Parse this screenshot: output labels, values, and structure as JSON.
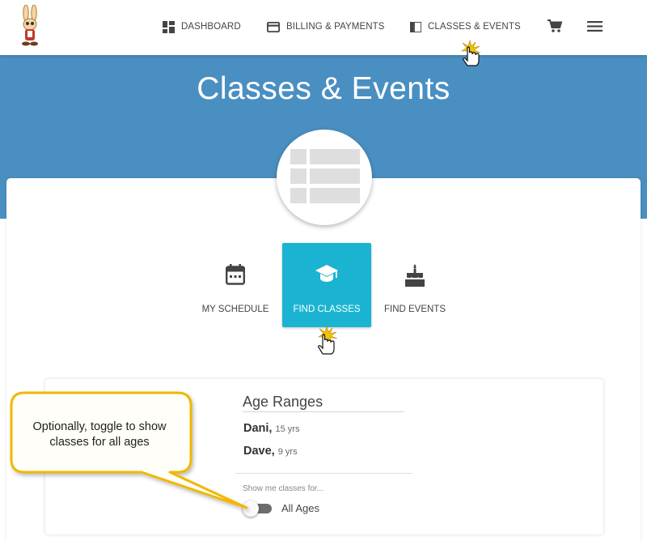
{
  "nav": {
    "items": [
      {
        "label": "DASHBOARD",
        "icon": "dashboard-icon"
      },
      {
        "label": "BILLING & PAYMENTS",
        "icon": "credit-card-icon"
      },
      {
        "label": "CLASSES & EVENTS",
        "icon": "book-icon"
      }
    ],
    "cart_icon": "cart-icon",
    "menu_icon": "hamburger-menu-icon"
  },
  "hero": {
    "title": "Classes & Events"
  },
  "tabs": [
    {
      "label": "MY SCHEDULE",
      "icon": "calendar-icon",
      "active": false
    },
    {
      "label": "FIND CLASSES",
      "icon": "graduation-cap-icon",
      "active": true
    },
    {
      "label": "FIND EVENTS",
      "icon": "cake-icon",
      "active": false
    }
  ],
  "age_ranges": {
    "title": "Age Ranges",
    "children": [
      {
        "name": "Dani,",
        "age": "15 yrs"
      },
      {
        "name": "Dave,",
        "age": "9 yrs"
      }
    ],
    "show_label": "Show me classes for...",
    "toggle_label": "All Ages",
    "toggle_on": false
  },
  "callout": {
    "text": "Optionally, toggle to show classes for all ages"
  },
  "colors": {
    "hero": "#4a8fc1",
    "active_tab": "#1ab4d2",
    "callout_fill": "#fffef8",
    "callout_border": "#f0b800"
  }
}
